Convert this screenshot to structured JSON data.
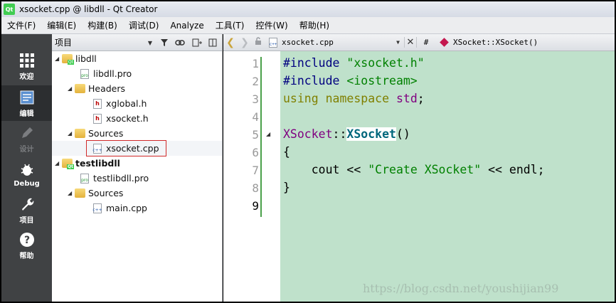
{
  "window": {
    "title": "xsocket.cpp @ libdll - Qt Creator",
    "logo": "Qt"
  },
  "menu": [
    "文件(F)",
    "编辑(E)",
    "构建(B)",
    "调试(D)",
    "Analyze",
    "工具(T)",
    "控件(W)",
    "帮助(H)"
  ],
  "modes": [
    {
      "label": "欢迎",
      "icon": "grid-icon",
      "state": "normal"
    },
    {
      "label": "编辑",
      "icon": "document-icon",
      "state": "active"
    },
    {
      "label": "设计",
      "icon": "pencil-icon",
      "state": "disabled"
    },
    {
      "label": "Debug",
      "icon": "bug-icon",
      "state": "normal"
    },
    {
      "label": "项目",
      "icon": "wrench-icon",
      "state": "normal"
    },
    {
      "label": "帮助",
      "icon": "help-icon",
      "state": "normal"
    }
  ],
  "project": {
    "title": "项目",
    "tree": [
      {
        "label": "libdll",
        "type": "project"
      },
      {
        "label": "libdll.pro",
        "type": "pro"
      },
      {
        "label": "Headers",
        "type": "folder-h"
      },
      {
        "label": "xglobal.h",
        "type": "h"
      },
      {
        "label": "xsocket.h",
        "type": "h"
      },
      {
        "label": "Sources",
        "type": "folder-src"
      },
      {
        "label": "xsocket.cpp",
        "type": "cpp",
        "selected": true
      },
      {
        "label": "testlibdll",
        "type": "project",
        "bold": true
      },
      {
        "label": "testlibdll.pro",
        "type": "pro"
      },
      {
        "label": "Sources",
        "type": "folder-src"
      },
      {
        "label": "main.cpp",
        "type": "cpp"
      }
    ]
  },
  "editor": {
    "file": "xsocket.cpp",
    "hash": "#",
    "symbol": "XSocket::XSocket()",
    "current_line": 9,
    "lines": [
      {
        "n": "1",
        "parts": [
          [
            "kw-pre",
            "#include "
          ],
          [
            "str",
            "\"xsocket.h\""
          ]
        ]
      },
      {
        "n": "2",
        "parts": [
          [
            "kw-pre",
            "#include "
          ],
          [
            "str",
            "<iostream>"
          ]
        ]
      },
      {
        "n": "3",
        "parts": [
          [
            "kw",
            "using"
          ],
          [
            "plain",
            " "
          ],
          [
            "kw",
            "namespace"
          ],
          [
            "plain",
            " "
          ],
          [
            "cls",
            "std"
          ],
          [
            "plain",
            ";"
          ]
        ]
      },
      {
        "n": "4",
        "parts": []
      },
      {
        "n": "5",
        "parts": [
          [
            "cls",
            "XSocket"
          ],
          [
            "plain",
            "::"
          ],
          [
            "fn-hl",
            "XSocket"
          ],
          [
            "plain",
            "()"
          ]
        ]
      },
      {
        "n": "6",
        "parts": [
          [
            "plain",
            "{"
          ]
        ]
      },
      {
        "n": "7",
        "parts": [
          [
            "plain",
            "    cout << "
          ],
          [
            "str",
            "\"Create XSocket\""
          ],
          [
            "plain",
            " << endl;"
          ]
        ]
      },
      {
        "n": "8",
        "parts": [
          [
            "plain",
            "}"
          ]
        ]
      },
      {
        "n": "9",
        "parts": []
      }
    ]
  },
  "watermark": "https://blog.csdn.net/youshijian99",
  "colors": {
    "editor_bg": "#bfe1cb",
    "mode_bar": "#404244",
    "selection_box": "#d12a2a"
  }
}
